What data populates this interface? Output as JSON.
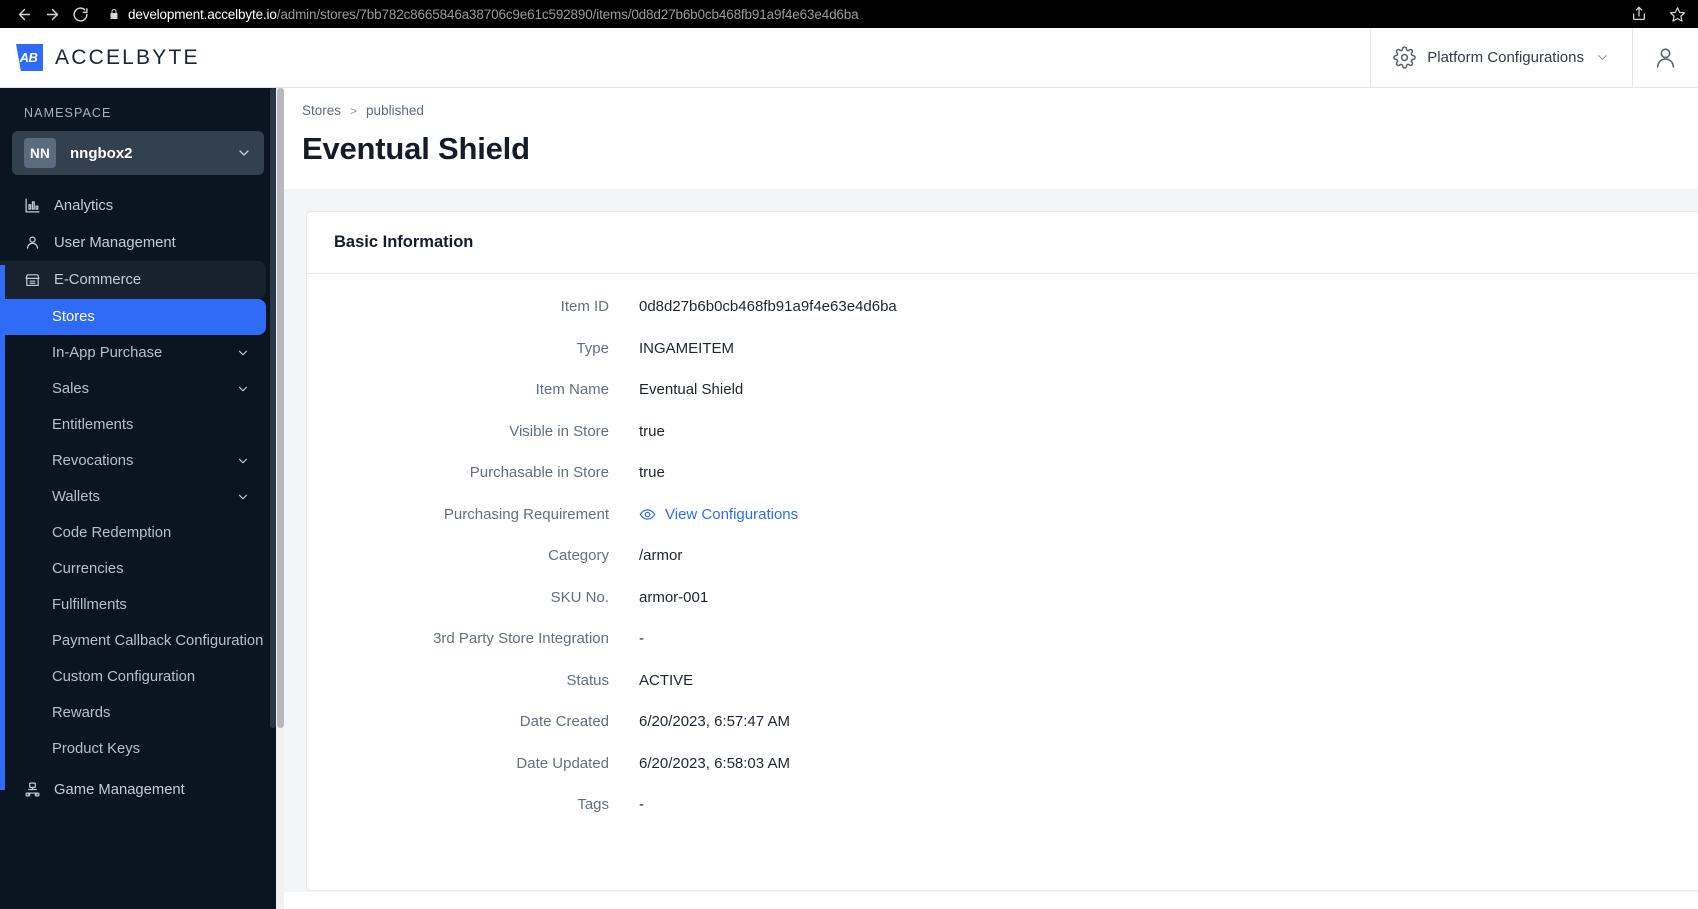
{
  "browser": {
    "back_icon": "arrow-left-icon",
    "forward_icon": "arrow-right-icon",
    "reload_icon": "reload-icon",
    "lock_icon": "lock-icon",
    "url_host": "development.accelbyte.io",
    "url_path": "/admin/stores/7bb782c8665846a38706c9e61c592890/items/0d8d27b6b0cb468fb91a9f4e63e4d6ba",
    "share_icon": "share-icon",
    "bookmark_icon": "star-icon"
  },
  "header": {
    "logo_mark": "AB",
    "brand": "ACCELBYTE",
    "gear_icon": "gear-icon",
    "platform_configurations": "Platform Configurations",
    "chevron_icon": "chevron-down-icon",
    "account_icon": "user-icon"
  },
  "sidebar": {
    "namespace_label": "NAMESPACE",
    "namespace_initials": "NN",
    "namespace_name": "nngbox2",
    "namespace_chevron": "chevron-down-icon",
    "items": [
      {
        "label": "Analytics",
        "icon": "bar-chart-icon",
        "level": "top",
        "state": "default"
      },
      {
        "label": "User Management",
        "icon": "user-icon",
        "level": "top",
        "state": "default"
      },
      {
        "label": "E-Commerce",
        "icon": "store-icon",
        "level": "top",
        "state": "section-active"
      },
      {
        "label": "Stores",
        "level": "sub",
        "state": "selected"
      },
      {
        "label": "In-App Purchase",
        "level": "sub",
        "state": "default",
        "caret": "chevron-down-icon"
      },
      {
        "label": "Sales",
        "level": "sub",
        "state": "default",
        "caret": "chevron-down-icon"
      },
      {
        "label": "Entitlements",
        "level": "sub",
        "state": "default"
      },
      {
        "label": "Revocations",
        "level": "sub",
        "state": "default",
        "caret": "chevron-down-icon"
      },
      {
        "label": "Wallets",
        "level": "sub",
        "state": "default",
        "caret": "chevron-down-icon"
      },
      {
        "label": "Code Redemption",
        "level": "sub",
        "state": "default"
      },
      {
        "label": "Currencies",
        "level": "sub",
        "state": "default"
      },
      {
        "label": "Fulfillments",
        "level": "sub",
        "state": "default"
      },
      {
        "label": "Payment Callback Configuration",
        "level": "sub",
        "state": "default"
      },
      {
        "label": "Custom Configuration",
        "level": "sub",
        "state": "default"
      },
      {
        "label": "Rewards",
        "level": "sub",
        "state": "default"
      },
      {
        "label": "Product Keys",
        "level": "sub",
        "state": "default"
      },
      {
        "label": "Game Management",
        "icon": "game-icon",
        "level": "top",
        "state": "default"
      }
    ]
  },
  "breadcrumb": {
    "root": "Stores",
    "separator": ">",
    "current": "published"
  },
  "page": {
    "title": "Eventual Shield"
  },
  "card": {
    "title": "Basic Information",
    "fields": [
      {
        "label": "Item ID",
        "value": "0d8d27b6b0cb468fb91a9f4e63e4d6ba",
        "type": "text"
      },
      {
        "label": "Type",
        "value": "INGAMEITEM",
        "type": "text"
      },
      {
        "label": "Item Name",
        "value": "Eventual Shield",
        "type": "text"
      },
      {
        "label": "Visible in Store",
        "value": "true",
        "type": "text"
      },
      {
        "label": "Purchasable in Store",
        "value": "true",
        "type": "text"
      },
      {
        "label": "Purchasing Requirement",
        "value": "View Configurations",
        "type": "link",
        "icon": "eye-icon"
      },
      {
        "label": "Category",
        "value": "/armor",
        "type": "text"
      },
      {
        "label": "SKU No.",
        "value": "armor-001",
        "type": "text"
      },
      {
        "label": "3rd Party Store Integration",
        "value": "-",
        "type": "text"
      },
      {
        "label": "Status",
        "value": "ACTIVE",
        "type": "text"
      },
      {
        "label": "Date Created",
        "value": "6/20/2023, 6:57:47 AM",
        "type": "text"
      },
      {
        "label": "Date Updated",
        "value": "6/20/2023, 6:58:03 AM",
        "type": "text"
      },
      {
        "label": "Tags",
        "value": "-",
        "type": "text"
      }
    ]
  },
  "colors": {
    "accent": "#2f6bf7",
    "sidebar_bg": "#0b1522",
    "content_bg": "#f4f5f7",
    "label_text": "#626f80"
  }
}
